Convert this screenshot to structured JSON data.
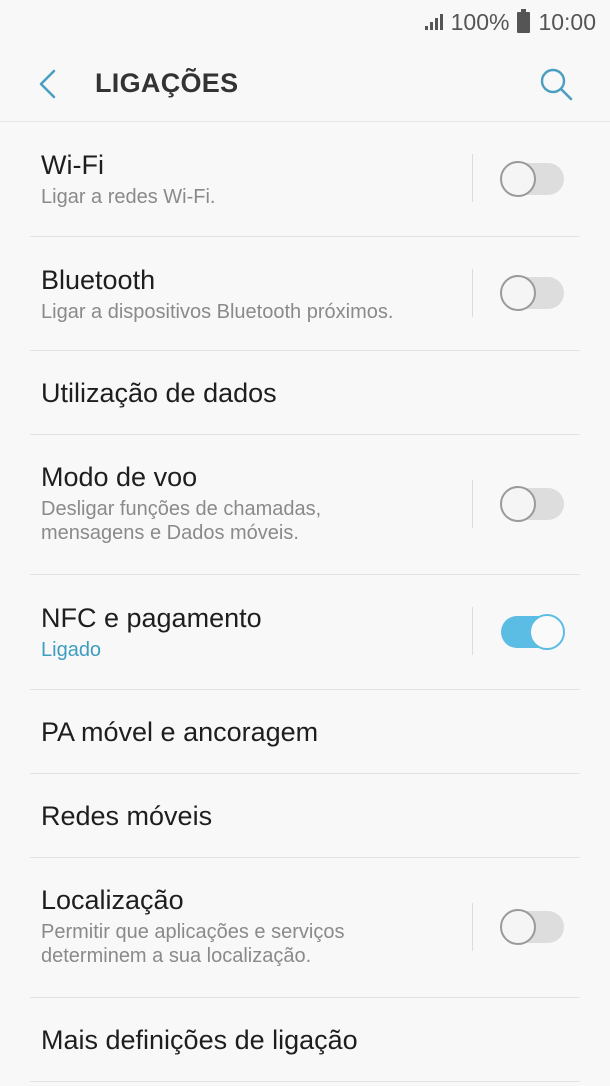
{
  "status_bar": {
    "battery_percent": "100%",
    "time": "10:00",
    "icons": [
      "signal-icon",
      "battery-icon"
    ]
  },
  "header": {
    "title": "LIGAÇÕES",
    "back_icon": "back-arrow-icon",
    "search_icon": "search-icon"
  },
  "colors": {
    "accent": "#5bbde4",
    "link": "#3e9ec2",
    "background": "#f8f8f8"
  },
  "settings": [
    {
      "title": "Wi-Fi",
      "subtitle": "Ligar a redes Wi-Fi.",
      "toggle": false
    },
    {
      "title": "Bluetooth",
      "subtitle": "Ligar a dispositivos Bluetooth próximos.",
      "toggle": false
    },
    {
      "title": "Utilização de dados"
    },
    {
      "title": "Modo de voo",
      "subtitle_lines": [
        "Desligar funções de chamadas,",
        "mensagens e Dados móveis."
      ],
      "toggle": false
    },
    {
      "title": "NFC e pagamento",
      "subtitle": "Ligado",
      "toggle": true
    },
    {
      "title": "PA móvel e ancoragem"
    },
    {
      "title": "Redes móveis"
    },
    {
      "title": "Localização",
      "subtitle_lines": [
        "Permitir que aplicações e serviços",
        "determinem a sua localização."
      ],
      "toggle": false
    },
    {
      "title": "Mais definições de ligação"
    }
  ]
}
